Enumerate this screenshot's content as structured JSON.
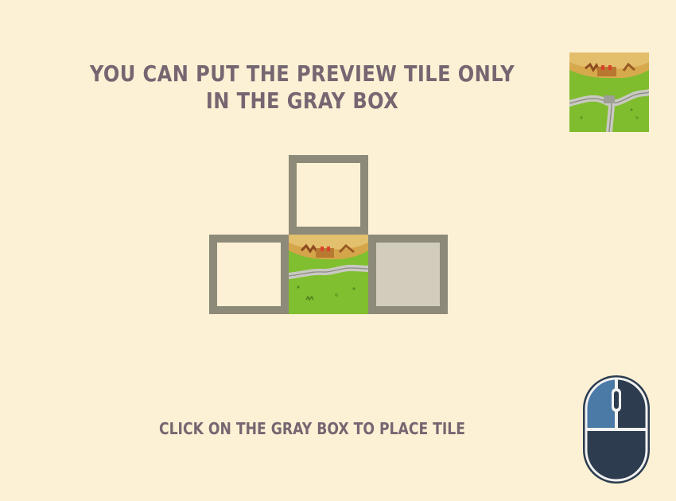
{
  "instructions": {
    "headline": "You can put the preview tile only in the gray box",
    "action_hint": "Click on the gray box to place tile"
  },
  "preview_tile": {
    "type": "city-with-road",
    "rotation_deg": 0
  },
  "board": {
    "placed_tile": {
      "type": "city-with-road"
    },
    "slots": [
      {
        "id": "top",
        "state": "empty"
      },
      {
        "id": "left",
        "state": "empty"
      },
      {
        "id": "right",
        "state": "highlighted-gray"
      }
    ]
  },
  "icons": {
    "mouse": "mouse-left-click-icon"
  },
  "colors": {
    "background": "#fcf1d4",
    "text": "#766671",
    "slot_border": "#8e8a79",
    "active_slot_fill": "#d1ccbb",
    "mouse_body": "#2d3c4f",
    "mouse_left_button": "#4a7aa5"
  }
}
